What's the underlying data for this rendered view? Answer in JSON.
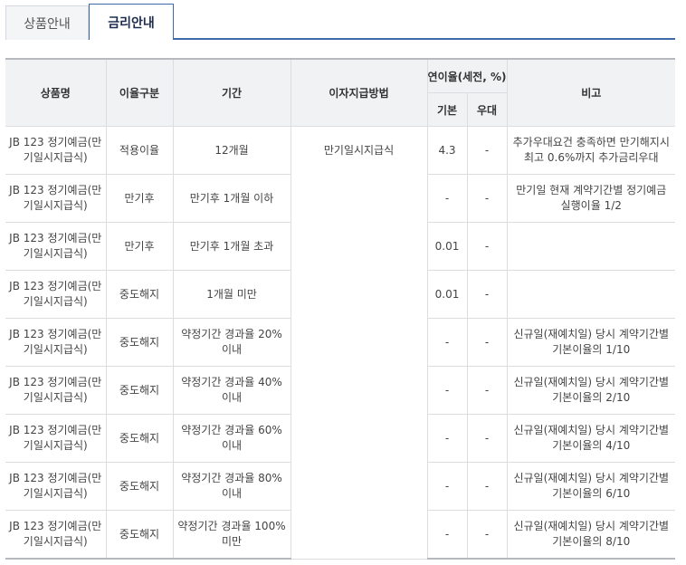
{
  "tabs": [
    {
      "label": "상품안내",
      "active": false
    },
    {
      "label": "금리안내",
      "active": true
    }
  ],
  "table": {
    "headers": {
      "name": "상품명",
      "rate_type": "이율구분",
      "period": "기간",
      "payment": "이자지급방법",
      "annual_rate": "연이율(세전, %)",
      "base": "기본",
      "preferential": "우대",
      "note": "비고"
    },
    "rows": [
      {
        "name": "JB 123 정기예금(만기일시지급식)",
        "rate_type": "적용이율",
        "period": "12개월",
        "payment": "만기일시지급식",
        "base": "4.3",
        "preferential": "-",
        "note": "추가우대요건 충족하면 만기해지시 최고 0.6%까지 추가금리우대"
      },
      {
        "name": "JB 123 정기예금(만기일시지급식)",
        "rate_type": "만기후",
        "period": "만기후 1개월 이하",
        "payment": "",
        "base": "-",
        "preferential": "-",
        "note": "만기일 현재 계약기간별 정기예금 실행이율 1/2"
      },
      {
        "name": "JB 123 정기예금(만기일시지급식)",
        "rate_type": "만기후",
        "period": "만기후 1개월 초과",
        "payment": "",
        "base": "0.01",
        "preferential": "-",
        "note": ""
      },
      {
        "name": "JB 123 정기예금(만기일시지급식)",
        "rate_type": "중도해지",
        "period": "1개월 미만",
        "payment": "",
        "base": "0.01",
        "preferential": "-",
        "note": ""
      },
      {
        "name": "JB 123 정기예금(만기일시지급식)",
        "rate_type": "중도해지",
        "period": "약정기간 경과율 20%이내",
        "payment": "",
        "base": "-",
        "preferential": "-",
        "note": "신규일(재예치일) 당시 계약기간별 기본이율의 1/10"
      },
      {
        "name": "JB 123 정기예금(만기일시지급식)",
        "rate_type": "중도해지",
        "period": "약정기간 경과율 40%이내",
        "payment": "",
        "base": "-",
        "preferential": "-",
        "note": "신규일(재예치일) 당시 계약기간별 기본이율의 2/10"
      },
      {
        "name": "JB 123 정기예금(만기일시지급식)",
        "rate_type": "중도해지",
        "period": "약정기간 경과율 60%이내",
        "payment": "",
        "base": "-",
        "preferential": "-",
        "note": "신규일(재예치일) 당시 계약기간별 기본이율의 4/10"
      },
      {
        "name": "JB 123 정기예금(만기일시지급식)",
        "rate_type": "중도해지",
        "period": "약정기간 경과율 80%이내",
        "payment": "",
        "base": "-",
        "preferential": "-",
        "note": "신규일(재예치일) 당시 계약기간별 기본이율의 6/10"
      },
      {
        "name": "JB 123 정기예금(만기일시지급식)",
        "rate_type": "중도해지",
        "period": "약정기간 경과율 100%미만",
        "payment": "",
        "base": "-",
        "preferential": "-",
        "note": "신규일(재예치일) 당시 계약기간별 기본이율의 8/10"
      }
    ]
  }
}
